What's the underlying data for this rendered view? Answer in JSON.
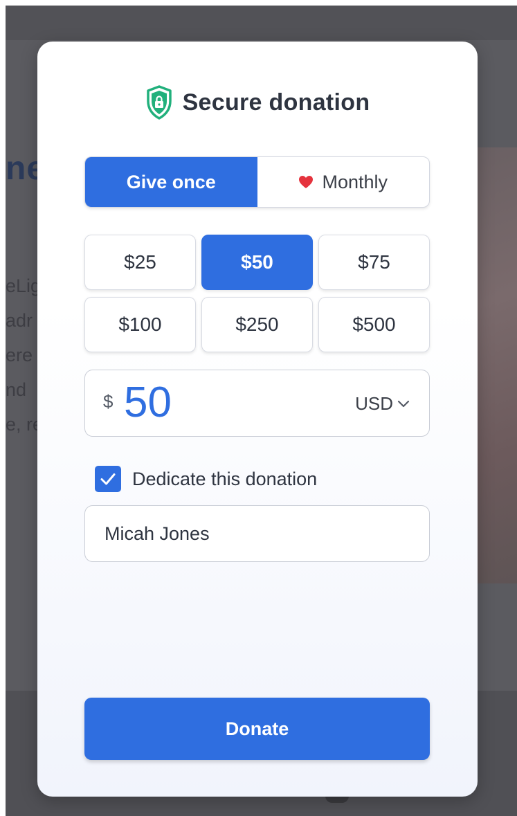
{
  "modal": {
    "title": "Secure donation",
    "icon": "shield-lock-icon",
    "accent_color": "#2f6ee0",
    "shield_color": "#21b07c"
  },
  "frequency": {
    "options": [
      {
        "label": "Give once",
        "selected": true
      },
      {
        "label": "Monthly",
        "selected": false,
        "icon": "heart-icon"
      }
    ]
  },
  "amounts": [
    {
      "label": "$25",
      "selected": false
    },
    {
      "label": "$50",
      "selected": true
    },
    {
      "label": "$75",
      "selected": false
    },
    {
      "label": "$100",
      "selected": false
    },
    {
      "label": "$250",
      "selected": false
    },
    {
      "label": "$500",
      "selected": false
    }
  ],
  "amount_input": {
    "symbol": "$",
    "value": "50",
    "currency": "USD"
  },
  "dedicate": {
    "label": "Dedicate this donation",
    "checked": true
  },
  "honoree": {
    "value": "Micah Jones"
  },
  "donate_button": {
    "label": "Donate"
  },
  "background": {
    "heading_fragment": "ne",
    "text_fragments": [
      "eLig",
      "adr",
      "ere",
      "nd",
      "e, re"
    ]
  }
}
